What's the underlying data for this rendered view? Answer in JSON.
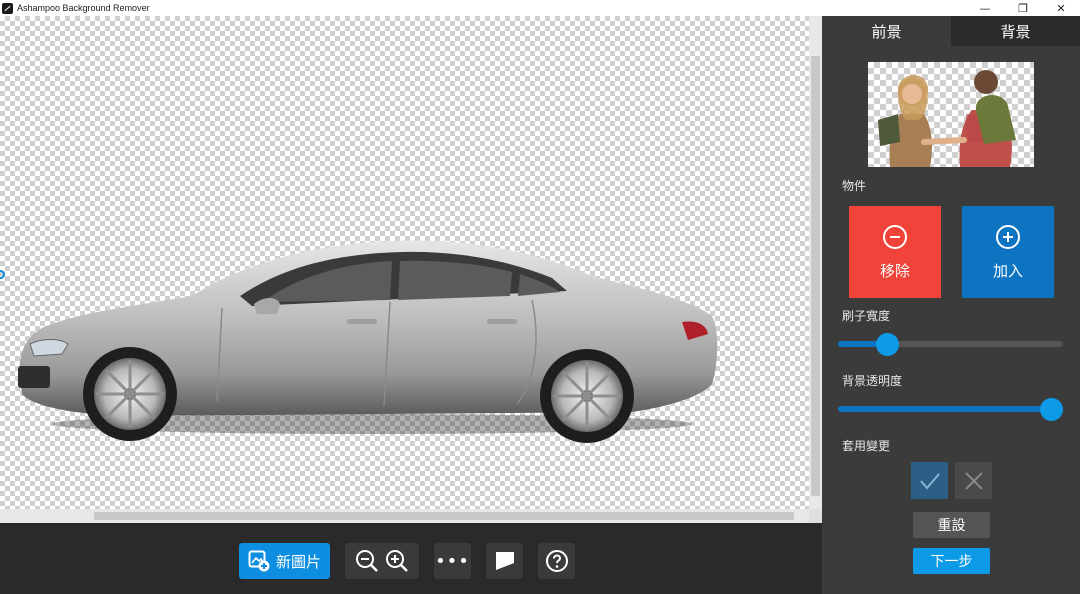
{
  "window": {
    "title": "Ashampoo Background Remover",
    "controls": {
      "minimize": "—",
      "restore": "❐",
      "close": "✕"
    }
  },
  "toolbar": {
    "new_image_label": "新圖片",
    "more_label": "•••"
  },
  "sidebar": {
    "tabs": [
      {
        "label": "前景",
        "active": true
      },
      {
        "label": "背景",
        "active": false
      }
    ],
    "object_section_label": "物件",
    "remove_label": "移除",
    "add_label": "加入",
    "brush_width_label": "刷子寬度",
    "brush_width_value": 0.22,
    "bg_opacity_label": "背景透明度",
    "bg_opacity_value": 1.0,
    "apply_changes_label": "套用變更",
    "reset_label": "重設",
    "next_label": "下一步"
  },
  "colors": {
    "accent": "#0d9be8",
    "remove": "#f0443a",
    "add": "#0d74c2",
    "sidebar_bg": "#3b3b3b"
  },
  "icons": [
    "app-icon",
    "minimize-icon",
    "restore-icon",
    "close-icon",
    "new-image-icon",
    "zoom-out-icon",
    "zoom-in-icon",
    "more-icon",
    "compare-icon",
    "help-icon",
    "minus-circle-icon",
    "plus-circle-icon",
    "check-icon",
    "cross-icon"
  ]
}
